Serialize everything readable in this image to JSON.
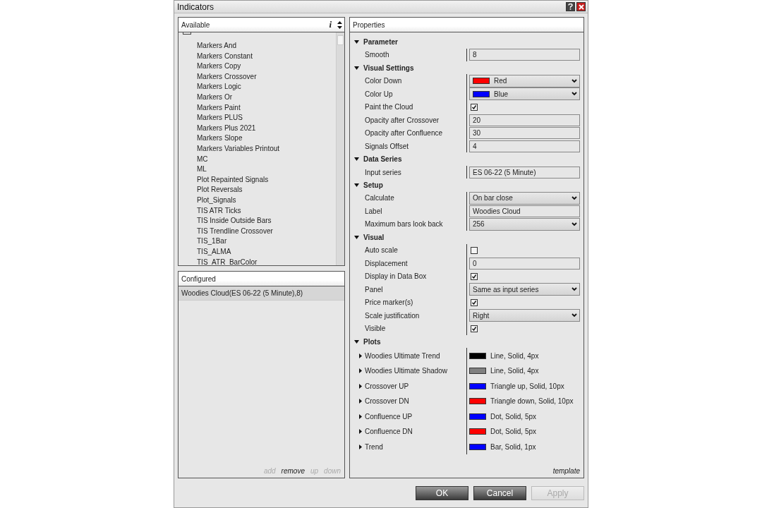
{
  "window": {
    "title": "Indicators"
  },
  "available": {
    "title": "Available",
    "info": "i",
    "items": [
      "Markers And",
      "Markers Constant",
      "Markers Copy",
      "Markers Crossover",
      "Markers Logic",
      "Markers Or",
      "Markers Paint",
      "Markers PLUS",
      "Markers Plus 2021",
      "Markers Slope",
      "Markers Variables Printout",
      "MC",
      "ML",
      "Plot Repainted Signals",
      "Plot Reversals",
      "Plot_Signals",
      "TIS ATR Ticks",
      "TIS Inside Outside Bars",
      "TIS Trendline Crossover",
      "TIS_1Bar",
      "TIS_ALMA",
      "TIS_ATR_BarColor"
    ]
  },
  "configured": {
    "title": "Configured",
    "items": [
      {
        "label": "Woodies Cloud(ES 06-22 (5 Minute),8)",
        "selected": true
      }
    ],
    "actions": [
      {
        "label": "add",
        "disabled": true
      },
      {
        "label": "remove",
        "disabled": false
      },
      {
        "label": "up",
        "disabled": true
      },
      {
        "label": "down",
        "disabled": true
      }
    ]
  },
  "properties": {
    "title": "Properties",
    "template": "template",
    "categories": [
      {
        "name": "Parameter",
        "expanded": true,
        "rows": [
          {
            "kind": "text",
            "label": "Smooth",
            "value": "8"
          }
        ]
      },
      {
        "name": "Visual Settings",
        "expanded": true,
        "rows": [
          {
            "kind": "color",
            "label": "Color Down",
            "value": "Red",
            "color": "#ff0000"
          },
          {
            "kind": "color",
            "label": "Color Up",
            "value": "Blue",
            "color": "#0000ff"
          },
          {
            "kind": "checkbox",
            "label": "Paint the Cloud",
            "checked": true
          },
          {
            "kind": "text",
            "label": "Opacity after Crossover",
            "value": "20"
          },
          {
            "kind": "text",
            "label": "Opacity after Confluence",
            "value": "30"
          },
          {
            "kind": "text",
            "label": "Signals Offset",
            "value": "4"
          }
        ]
      },
      {
        "name": "Data Series",
        "expanded": true,
        "rows": [
          {
            "kind": "text",
            "label": "Input series",
            "value": "ES 06-22 (5 Minute)"
          }
        ]
      },
      {
        "name": "Setup",
        "expanded": true,
        "rows": [
          {
            "kind": "select",
            "label": "Calculate",
            "value": "On bar close"
          },
          {
            "kind": "text",
            "label": "Label",
            "value": "Woodies Cloud"
          },
          {
            "kind": "select",
            "label": "Maximum bars look back",
            "value": "256"
          }
        ]
      },
      {
        "name": "Visual",
        "expanded": true,
        "rows": [
          {
            "kind": "checkbox",
            "label": "Auto scale",
            "checked": false
          },
          {
            "kind": "text",
            "label": "Displacement",
            "value": "0"
          },
          {
            "kind": "checkbox",
            "label": "Display in Data Box",
            "checked": true
          },
          {
            "kind": "select",
            "label": "Panel",
            "value": "Same as input series"
          },
          {
            "kind": "checkbox",
            "label": "Price marker(s)",
            "checked": true
          },
          {
            "kind": "select",
            "label": "Scale justification",
            "value": "Right"
          },
          {
            "kind": "checkbox",
            "label": "Visible",
            "checked": true
          }
        ]
      },
      {
        "name": "Plots",
        "expanded": true,
        "rows": [
          {
            "kind": "plot",
            "label": "Woodies Ultimate Trend",
            "value": "Line, Solid, 4px",
            "color": "#000000",
            "expanded": false
          },
          {
            "kind": "plot",
            "label": "Woodies Ultimate Shadow",
            "value": "Line, Solid, 4px",
            "color": "#808080",
            "expanded": false
          },
          {
            "kind": "plot",
            "label": "Crossover UP",
            "value": "Triangle up, Solid, 10px",
            "color": "#0000ff",
            "expanded": false
          },
          {
            "kind": "plot",
            "label": "Crossover DN",
            "value": "Triangle down, Solid, 10px",
            "color": "#ff0000",
            "expanded": false
          },
          {
            "kind": "plot",
            "label": "Confluence UP",
            "value": "Dot, Solid, 5px",
            "color": "#0000ff",
            "expanded": false
          },
          {
            "kind": "plot",
            "label": "Confluence DN",
            "value": "Dot, Solid, 5px",
            "color": "#ff0000",
            "expanded": false
          },
          {
            "kind": "plot",
            "label": "Trend",
            "value": "Bar, Solid, 1px",
            "color": "#0000ff",
            "expanded": false
          }
        ]
      }
    ]
  },
  "buttons": [
    {
      "label": "OK",
      "disabled": false
    },
    {
      "label": "Cancel",
      "disabled": false
    },
    {
      "label": "Apply",
      "disabled": true
    }
  ]
}
